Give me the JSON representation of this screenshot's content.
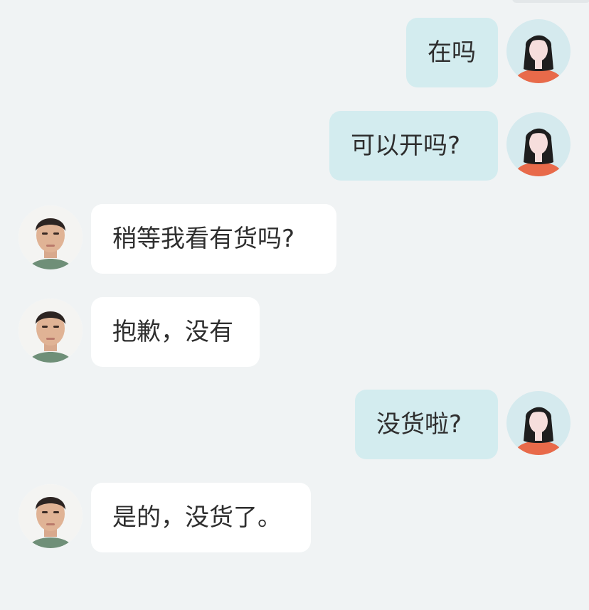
{
  "messages": [
    {
      "side": "sent",
      "text": "在吗",
      "avatar": "woman-avatar"
    },
    {
      "side": "sent",
      "text": "可以开吗?",
      "avatar": "woman-avatar"
    },
    {
      "side": "recv",
      "text": "稍等我看有货吗?",
      "avatar": "man-photo-avatar"
    },
    {
      "side": "recv",
      "text": "抱歉，没有",
      "avatar": "man-photo-avatar"
    },
    {
      "side": "sent",
      "text": "没货啦?",
      "avatar": "woman-avatar"
    },
    {
      "side": "recv",
      "text": "是的，没货了。",
      "avatar": "man-photo-avatar"
    }
  ],
  "colors": {
    "background": "#f0f3f4",
    "sent_bubble": "#d3ecef",
    "received_bubble": "#ffffff",
    "text": "#2e2e2e"
  }
}
